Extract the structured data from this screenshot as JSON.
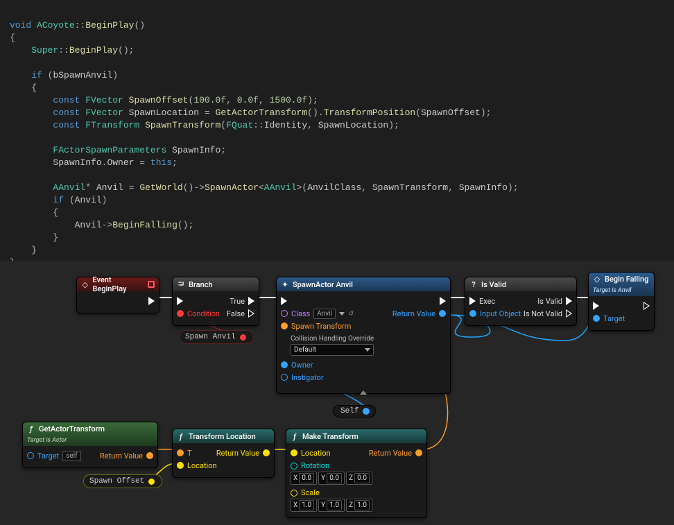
{
  "code": {
    "line1_void": "void",
    "line1_cls": "ACoyote",
    "line1_fn": "BeginPlay",
    "super_kw": "Super",
    "super_fn": "BeginPlay",
    "if_kw": "if",
    "cond_var": "bSpawnAnvil",
    "const_kw": "const",
    "fvector": "FVector",
    "ftransform": "FTransform",
    "spawnoffset": "SpawnOffset",
    "v1": "100.0f",
    "v2": "0.0f",
    "v3": "1500.0f",
    "spawnlocation": "SpawnLocation",
    "getactor": "GetActorTransform",
    "transformpos": "TransformPosition",
    "spawntransform": "SpawnTransform",
    "fquat": "FQuat",
    "identity": "Identity",
    "fasp": "FActorSpawnParameters",
    "spawninfo": "SpawnInfo",
    "owner": "Owner",
    "this_kw": "this",
    "aanvil": "AAnvil",
    "anvil": "Anvil",
    "getworld": "GetWorld",
    "spawnactor": "SpawnActor",
    "anvilclass": "AnvilClass",
    "beginfall": "BeginFalling"
  },
  "bp": {
    "evt_begin": "Event BeginPlay",
    "branch": "Branch",
    "true": "True",
    "false": "False",
    "condition": "Condition",
    "spawnanvil_var": "Spawn Anvil",
    "spawnactor_title": "SpawnActor Anvil",
    "class": "Class",
    "class_val": "Anvil",
    "spawn_tf": "Spawn Transform",
    "collision_label": "Collision Handling Override",
    "collision_val": "Default",
    "owner": "Owner",
    "instigator": "Instigator",
    "return_value": "Return Value",
    "isvalid": "Is Valid",
    "exec": "Exec",
    "input_obj": "Input Object",
    "is_valid": "Is Valid",
    "is_not_valid": "Is Not Valid",
    "beginfall": "Begin Falling",
    "target_anvil": "Target is Anvil",
    "target": "Target",
    "self": "Self",
    "gat": "GetActorTransform",
    "target_actor": "Target is Actor",
    "self_box": "self",
    "tl": "Transform Location",
    "t_in": "T",
    "loc_in": "Location",
    "mt": "Make Transform",
    "loc": "Location",
    "rot": "Rotation",
    "scale": "Scale",
    "rx": "0.0",
    "ry": "0.0",
    "rz": "0.0",
    "sx": "1.0",
    "sy": "1.0",
    "sz": "1.0",
    "spawnoffset_var": "Spawn Offset",
    "q_icon": "?",
    "f_icon": "ƒ",
    "branch_icon": "⮒",
    "diamond": "◇"
  }
}
